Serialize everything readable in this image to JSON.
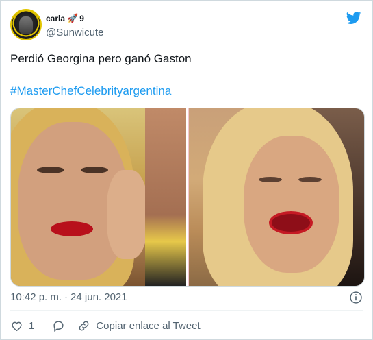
{
  "tweet": {
    "display_name": "carla",
    "display_name_suffix": "9",
    "handle": "@Sunwicute",
    "text": "Perdió Georgina pero ganó Gaston",
    "hashtag": "#MasterChefCelebrityargentina",
    "time": "10:42 p. m.",
    "separator": "·",
    "date": "24 jun. 2021"
  },
  "actions": {
    "like_count": "1",
    "copy_link_label": "Copiar enlace al Tweet"
  },
  "colors": {
    "twitter_blue": "#1d9bf0",
    "text_secondary": "#536471",
    "border": "#cfd9de"
  },
  "icons": {
    "twitter": "twitter-bird-icon",
    "info": "info-icon",
    "heart": "heart-icon",
    "reply": "reply-icon",
    "link": "link-icon"
  }
}
